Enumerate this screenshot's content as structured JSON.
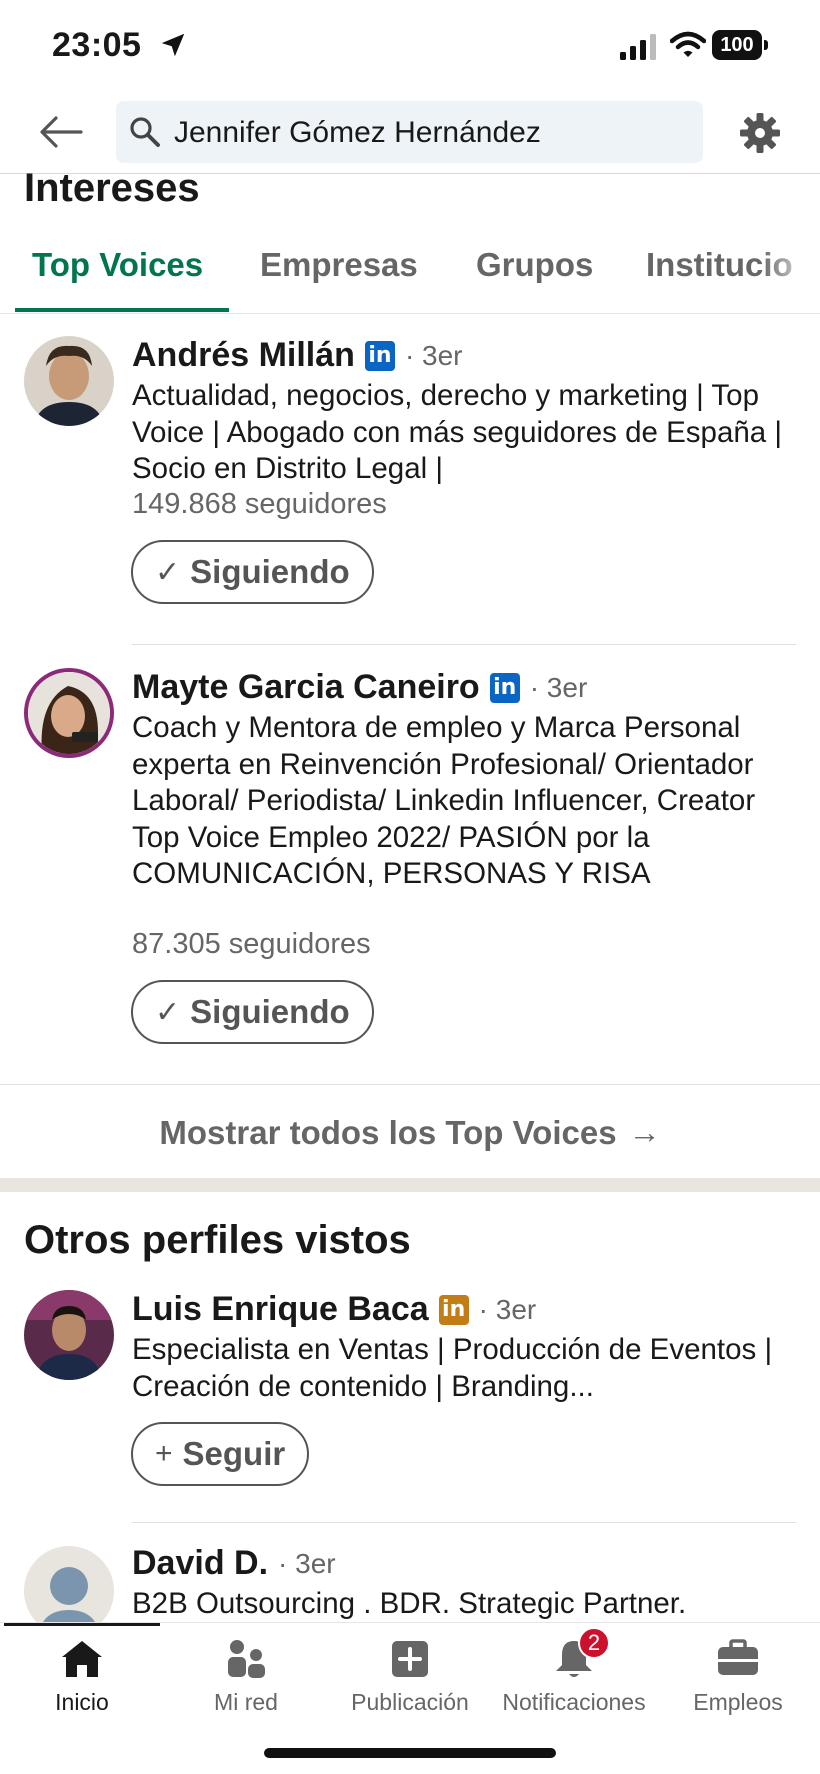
{
  "status_bar": {
    "time": "23:05",
    "battery": "100"
  },
  "search": {
    "query": "Jennifer Gómez Hernández"
  },
  "intereses": {
    "title": "Intereses",
    "tabs": [
      {
        "label": "Top Voices",
        "active": true
      },
      {
        "label": "Empresas"
      },
      {
        "label": "Grupos"
      },
      {
        "label": "Institucio"
      }
    ],
    "people": [
      {
        "name": "Andrés Millán",
        "badge": "in",
        "degree": "· 3er",
        "headline": "Actualidad, negocios, derecho y marketing | Top Voice | Abogado con más seguidores de España | Socio en Distrito Legal |",
        "followers": "149.868 seguidores",
        "button_icon": "✓",
        "button_label": "Siguiendo"
      },
      {
        "name": "Mayte Garcia Caneiro",
        "badge": "in",
        "degree": "· 3er",
        "headline": "Coach y Mentora de empleo y Marca Personal experta en Reinvención Profesional/ Orientador Laboral/ Periodista/ Linkedin Influencer, Creator Top Voice Empleo 2022/ PASIÓN por la COMUNICACIÓN, PERSONAS Y RISA",
        "followers": "87.305 seguidores",
        "button_icon": "✓",
        "button_label": "Siguiendo"
      }
    ],
    "show_all_label": "Mostrar todos los Top Voices",
    "show_all_arrow": "→"
  },
  "otros": {
    "title": "Otros perfiles vistos",
    "people": [
      {
        "name": "Luis Enrique Baca",
        "badge": "in",
        "degree": "· 3er",
        "headline": "Especialista en Ventas | Producción de Eventos | Creación de contenido | Branding...",
        "button_icon": "+",
        "button_label": "Seguir"
      },
      {
        "name": "David D.",
        "degree": "· 3er",
        "headline": "B2B Outsourcing . BDR. Strategic Partner."
      }
    ]
  },
  "bottom_nav": [
    {
      "label": "Inicio",
      "icon": "home-icon",
      "active": true
    },
    {
      "label": "Mi red",
      "icon": "network-icon"
    },
    {
      "label": "Publicación",
      "icon": "post-icon"
    },
    {
      "label": "Notificaciones",
      "icon": "bell-icon",
      "badge": "2"
    },
    {
      "label": "Empleos",
      "icon": "briefcase-icon"
    }
  ],
  "colors": {
    "accent_green": "#01754f",
    "linkedin_blue": "#0a66c2",
    "linkedin_gold": "#c37d16",
    "badge_red": "#cb112d",
    "search_bg": "#eef3f8"
  }
}
